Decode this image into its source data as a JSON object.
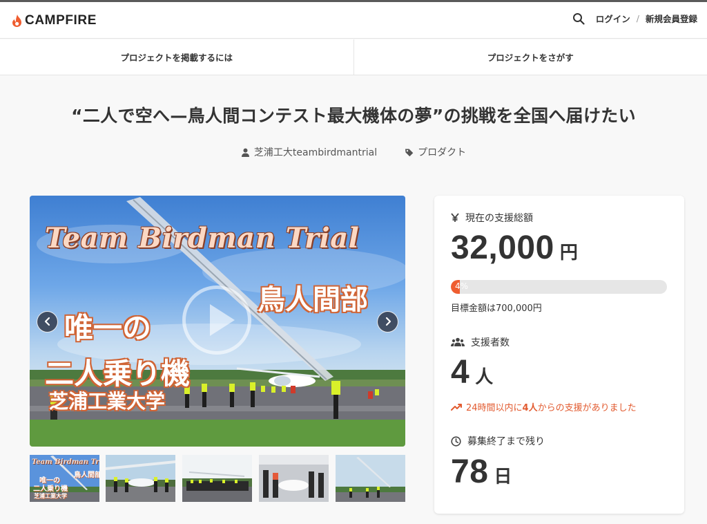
{
  "header": {
    "logo_text": "CAMPFIRE",
    "login_label": "ログイン",
    "separator": "/",
    "register_label": "新規会員登録"
  },
  "subnav": {
    "items": [
      "プロジェクトを掲載するには",
      "プロジェクトをさがす"
    ]
  },
  "project": {
    "title": "“二人で空へ—鳥人間コンテスト最大機体の夢”の挑戦を全国へ届けたい",
    "owner": "芝浦工大teambirdmantrial",
    "category": "プロダクト"
  },
  "hero": {
    "overlay_title": "Team Birdman Trial",
    "overlay_club": "鳥人間部",
    "overlay_line1": "唯一の",
    "overlay_line2": "二人乗り機",
    "overlay_school": "芝浦工業大学"
  },
  "thumbnails": {
    "first_title": "Team Birdman Trial",
    "first_club": "鳥人間部",
    "first_line1": "唯一の",
    "first_line2": "二人乗り機",
    "first_school": "芝浦工業大学"
  },
  "stats": {
    "amount_label": "現在の支援総額",
    "amount_value": "32,000",
    "amount_unit": "円",
    "progress_label": "4%",
    "progress_fraction": 0.04,
    "goal_text": "目標金額は700,000円",
    "backers_label": "支援者数",
    "backers_value": "4",
    "backers_unit": "人",
    "recent_prefix": "24時間以内に",
    "recent_count": "4人",
    "recent_suffix": "からの支援がありました",
    "remaining_label": "募集終了まで残り",
    "remaining_value": "78",
    "remaining_unit": "日"
  },
  "colors": {
    "brand": "#ef5d30",
    "text": "#333333",
    "accent_text": "#e25b30"
  },
  "icons": {
    "logo": "campfire-flame-icon",
    "search": "search-icon",
    "owner": "user-icon",
    "category": "tag-icon",
    "amount": "yen-icon",
    "backers": "users-icon",
    "trend": "trending-up-icon",
    "time": "clock-icon",
    "prev": "chevron-left-icon",
    "next": "chevron-right-icon",
    "play": "play-icon"
  }
}
